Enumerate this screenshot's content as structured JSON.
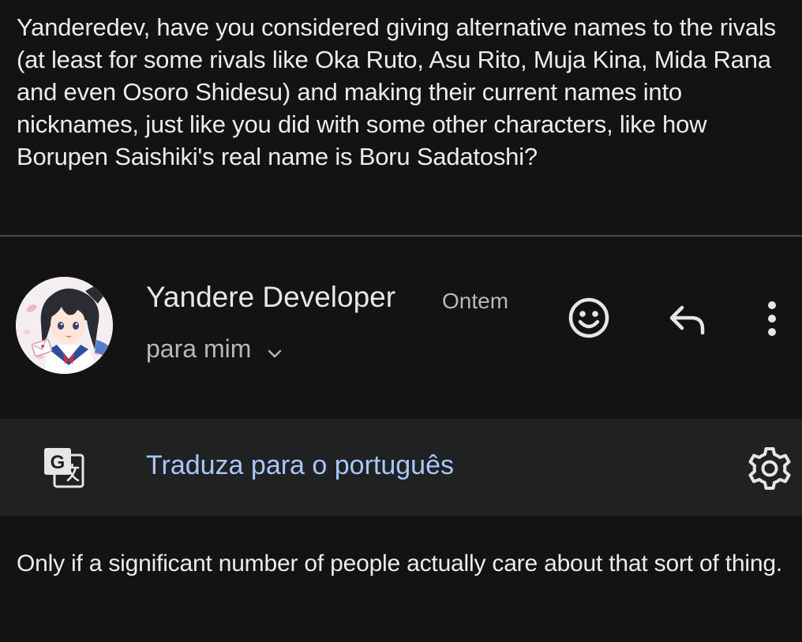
{
  "quoted_message": {
    "text": "Yanderedev, have you considered giving alternative names to the rivals (at least for some rivals like Oka Ruto, Asu Rito, Muja Kina, Mida Rana and even Osoro Shidesu) and making their current names into nicknames, just like you did with some other characters, like how Borupen Saishiki's real name is Boru Sadatoshi?"
  },
  "header": {
    "sender_name": "Yandere Developer",
    "time": "Ontem",
    "recipient": "para mim",
    "avatar_icon": "anime-girl-avatar",
    "actions": [
      {
        "name": "emoji-reaction",
        "icon": "smiley-icon"
      },
      {
        "name": "reply",
        "icon": "reply-arrow-icon"
      },
      {
        "name": "more-options",
        "icon": "vertical-dots-icon"
      }
    ]
  },
  "translate_bar": {
    "label": "Traduza para o português",
    "icon": "google-translate-icon",
    "settings_icon": "gear-icon"
  },
  "message": {
    "body": "Only if a significant number of people actually care about that sort of thing."
  },
  "colors": {
    "background": "#131314",
    "translate_bar": "#202123",
    "link": "#a8c7fa",
    "text": "#e3e3e3",
    "muted": "#b8b8b8"
  }
}
